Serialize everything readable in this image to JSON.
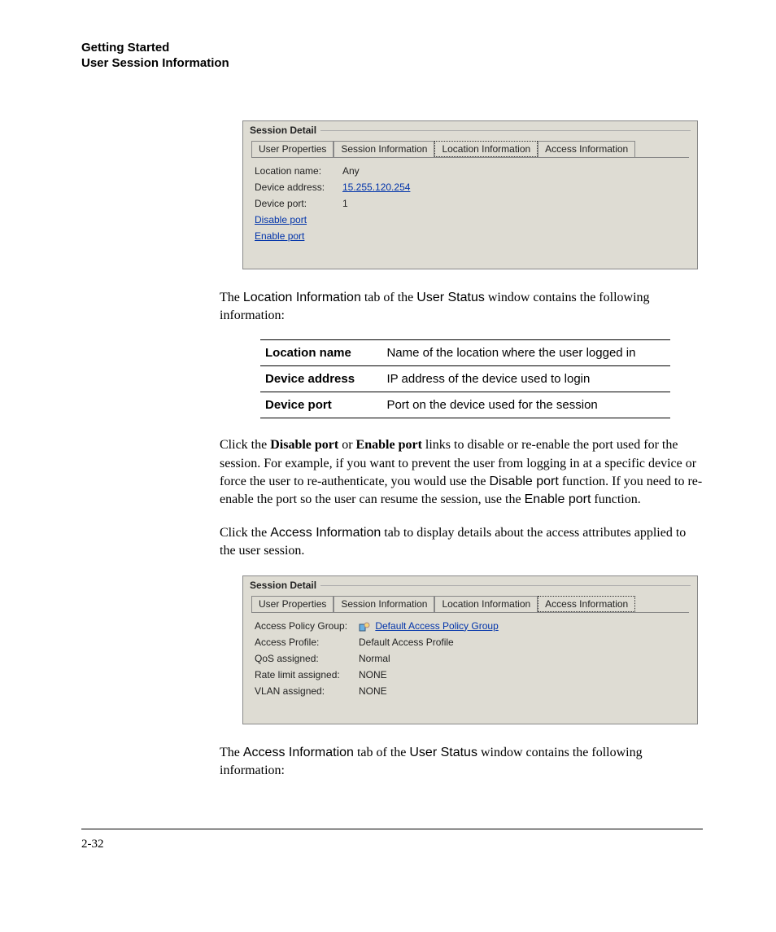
{
  "header": {
    "line1": "Getting Started",
    "line2": "User Session Information"
  },
  "screenshot1": {
    "title": "Session Detail",
    "tabs": [
      "User Properties",
      "Session Information",
      "Location Information",
      "Access Information"
    ],
    "selected_index": 2,
    "fields": [
      {
        "label": "Location name:",
        "value": "Any",
        "link": false
      },
      {
        "label": "Device address:",
        "value": "15.255.120.254",
        "link": true
      },
      {
        "label": "Device port:",
        "value": "1",
        "link": false
      }
    ],
    "action_links": [
      "Disable port",
      "Enable port"
    ]
  },
  "para1": {
    "pre": "The ",
    "term1": "Location Information",
    "mid1": " tab of the ",
    "term2": "User Status",
    "post": " window contains the following information:"
  },
  "def_table": [
    {
      "term": "Location name",
      "desc": "Name of the location where the user logged in"
    },
    {
      "term": "Device address",
      "desc": "IP address of the device used to login"
    },
    {
      "term": "Device port",
      "desc": "Port on the device used for the session"
    }
  ],
  "para2": {
    "t1": "Click the ",
    "b1": "Disable port",
    "t2": " or ",
    "b2": "Enable port",
    "t3": " links to disable or re-enable the port used for the session. For example, if you want to prevent the user from logging in at a specific device or force the user to re-authenticate, you would use the ",
    "ui1": "Disable port",
    "t4": " function. If you need to re-enable the port so the user can resume the session, use the ",
    "ui2": "Enable port",
    "t5": " function."
  },
  "para3": {
    "t1": "Click the ",
    "ui1": "Access Information",
    "t2": " tab to display details about the access attributes applied to the user session."
  },
  "screenshot2": {
    "title": "Session Detail",
    "tabs": [
      "User Properties",
      "Session Information",
      "Location Information",
      "Access Information"
    ],
    "selected_index": 3,
    "fields": [
      {
        "label": "Access Policy Group:",
        "value": "Default Access Policy Group",
        "link": true,
        "icon": true
      },
      {
        "label": "Access Profile:",
        "value": "Default Access Profile",
        "link": false
      },
      {
        "label": "QoS assigned:",
        "value": "Normal",
        "link": false
      },
      {
        "label": "Rate limit assigned:",
        "value": "NONE",
        "link": false
      },
      {
        "label": "VLAN assigned:",
        "value": "NONE",
        "link": false
      }
    ]
  },
  "para4": {
    "pre": "The ",
    "term1": "Access Information",
    "mid1": " tab of the ",
    "term2": "User Status",
    "post": " window contains the following information:"
  },
  "page_number": "2-32"
}
